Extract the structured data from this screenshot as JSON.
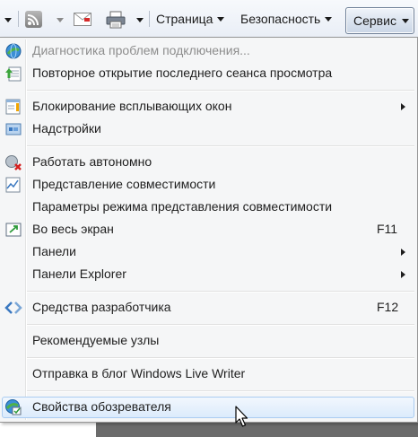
{
  "toolbar": {
    "page_label": "Страница",
    "security_label": "Безопасность",
    "tools_label": "Сервис"
  },
  "menu": {
    "items": [
      {
        "label": "Диагностика проблем подключения...",
        "disabled": true,
        "icon": "network-diagnostics-icon"
      },
      {
        "label": "Повторное открытие последнего сеанса просмотра",
        "icon": "reopen-session-icon"
      },
      {
        "label": "Блокирование всплывающих окон",
        "icon": "popup-blocker-icon"
      },
      {
        "label": "Надстройки",
        "icon": "addons-icon"
      },
      {
        "label": "Работать автономно",
        "icon": "work-offline-icon"
      },
      {
        "label": "Представление совместимости",
        "icon": "compatibility-view-icon"
      },
      {
        "label": "Параметры режима представления совместимости"
      },
      {
        "label": "Во весь экран",
        "shortcut": "F11",
        "icon": "fullscreen-icon"
      },
      {
        "label": "Панели"
      },
      {
        "label": "Панели Explorer"
      },
      {
        "label": "Средства разработчика",
        "shortcut": "F12",
        "icon": "developer-tools-icon"
      },
      {
        "label": "Рекомендуемые узлы"
      },
      {
        "label": "Отправка в блог Windows Live Writer"
      },
      {
        "label": "Свойства обозревателя",
        "highlighted": true,
        "icon": "internet-options-icon"
      }
    ]
  },
  "colors": {
    "menu_background": "#f5f6f7",
    "highlight_border": "#aaccf1",
    "disabled_text": "#8d8d8d"
  }
}
